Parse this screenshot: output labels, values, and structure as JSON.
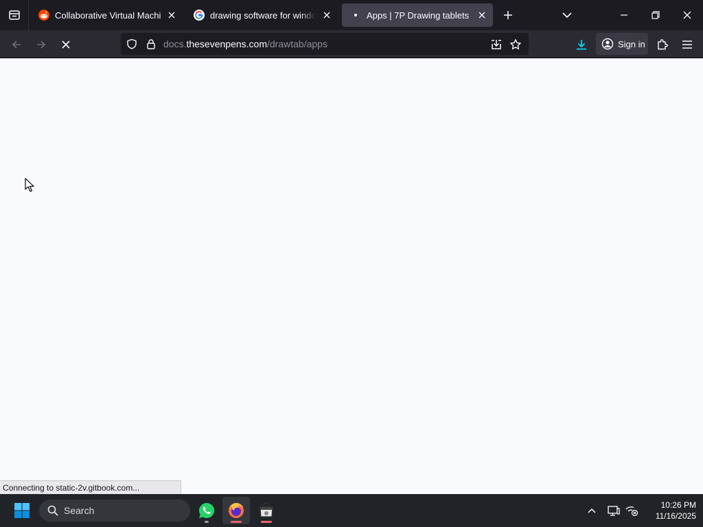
{
  "browser": {
    "tabs": [
      {
        "title": "Collaborative Virtual Machines!",
        "favicon": "reddit-icon",
        "active": false
      },
      {
        "title": "drawing software for windows free",
        "favicon": "google-icon",
        "active": false
      },
      {
        "title": "Apps | 7P Drawing tablets",
        "favicon": "loading-dot-icon",
        "active": true
      }
    ],
    "url": {
      "prefix": "docs.",
      "domain": "thesevenpens.com",
      "path": "/drawtab/apps"
    },
    "signin_label": "Sign in",
    "status_text": "Connecting to static-2v.gitbook.com...",
    "colors": {
      "tabstrip": "#1c1b22",
      "active_tab": "#42414d",
      "navbar": "#2b2a33",
      "download_accent": "#00ddff",
      "page_background": "#f8fafe"
    }
  },
  "taskbar": {
    "search_placeholder": "Search",
    "apps": [
      "whatsapp-icon",
      "firefox-icon",
      "store-icon"
    ],
    "time": "10:26 PM",
    "date": "11/16/2025"
  }
}
